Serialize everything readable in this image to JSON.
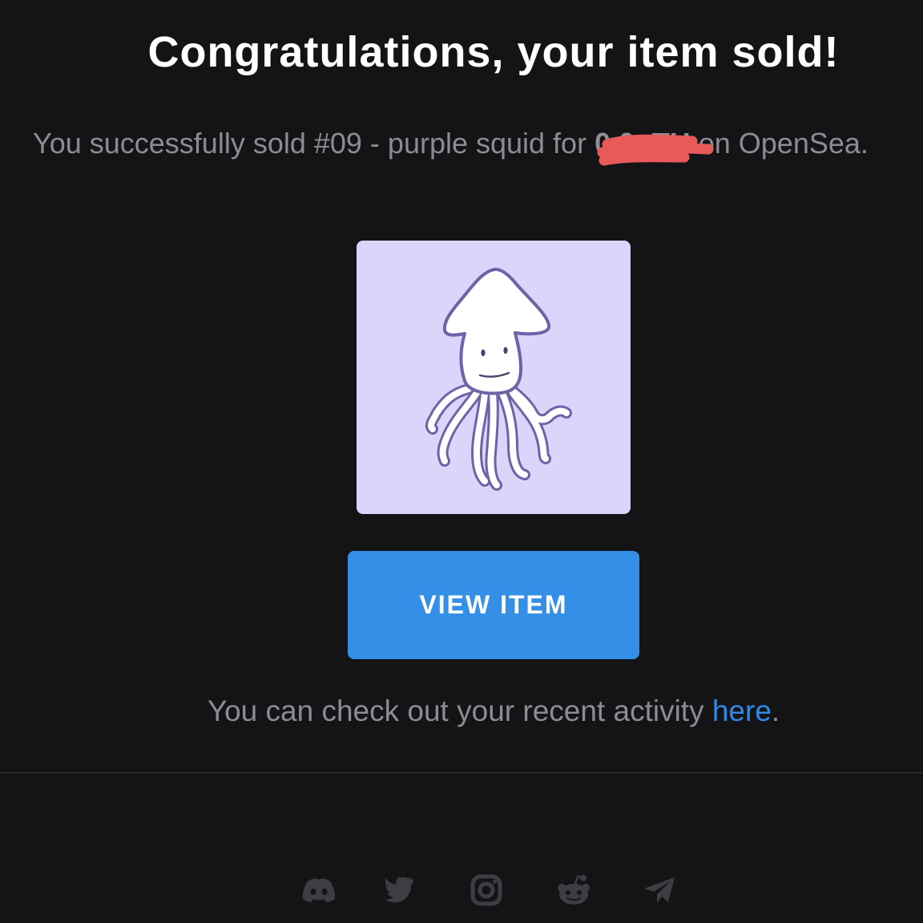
{
  "email": {
    "heading": "Congratulations, your item sold!",
    "message_prefix": "You successfully sold #09 - purple squid for ",
    "price_visible": "0.0   TH",
    "message_suffix": " on OpenSea.",
    "item_name": "#09 - purple squid",
    "marketplace": "OpenSea",
    "view_button_label": "VIEW ITEM",
    "activity_prefix": "You can check out your recent activity ",
    "activity_link": "here",
    "activity_suffix": "."
  },
  "colors": {
    "background": "#141416",
    "card_background": "#dcd5fb",
    "button": "#3390e6",
    "link": "#2e8ae6",
    "redaction": "#e85a5a"
  },
  "social_icons": [
    "discord-icon",
    "twitter-icon",
    "instagram-icon",
    "reddit-icon",
    "telegram-icon"
  ]
}
